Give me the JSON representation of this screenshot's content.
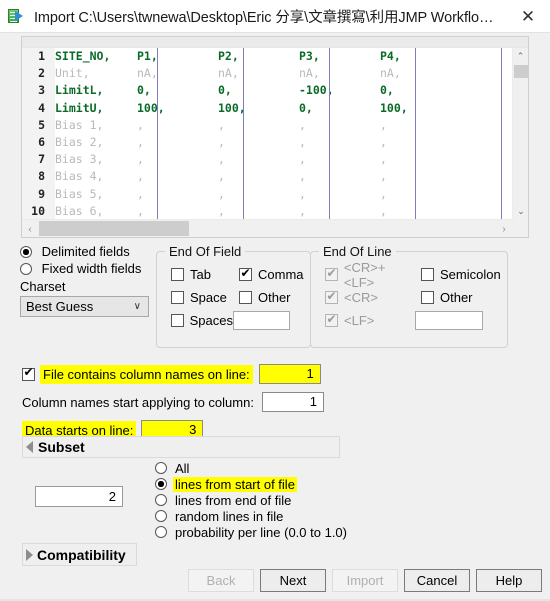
{
  "window": {
    "title": "Import C:\\Users\\twnewa\\Desktop\\Eric 分享\\文章撰寫\\利用JMP Workflow Builder ...",
    "close_label": "✕",
    "app_icon": "import-table-icon"
  },
  "preview": {
    "line_numbers": [
      "1",
      "2",
      "3",
      "4",
      "5",
      "6",
      "7",
      "8",
      "9",
      "10"
    ],
    "columns": [
      {
        "values": [
          "SITE_NO,",
          "Unit,",
          "LimitL,",
          "LimitU,",
          "Bias 1,",
          "Bias 2,",
          "Bias 3,",
          "Bias 4,",
          "Bias 5,",
          "Bias 6,"
        ],
        "styles": [
          "bold",
          "dim",
          "bold",
          "bold",
          "dim",
          "dim",
          "dim",
          "dim",
          "dim",
          "dim"
        ]
      },
      {
        "values": [
          "P1,",
          "nA,",
          "0,",
          "100,",
          ",",
          ",",
          ",",
          ",",
          ",",
          ","
        ],
        "styles": [
          "bold",
          "dim",
          "bold",
          "bold",
          "dim",
          "dim",
          "dim",
          "dim",
          "dim",
          "dim"
        ]
      },
      {
        "values": [
          "P2,",
          "nA,",
          "0,",
          "100,",
          ",",
          ",",
          ",",
          ",",
          ",",
          ","
        ],
        "styles": [
          "bold",
          "dim",
          "bold",
          "bold",
          "dim",
          "dim",
          "dim",
          "dim",
          "dim",
          "dim"
        ]
      },
      {
        "values": [
          "P3,",
          "nA,",
          "-100,",
          "0,",
          ",",
          ",",
          ",",
          ",",
          ",",
          ","
        ],
        "styles": [
          "bold",
          "dim",
          "bold",
          "bold",
          "dim",
          "dim",
          "dim",
          "dim",
          "dim",
          "dim"
        ]
      },
      {
        "values": [
          "P4,",
          "nA,",
          "0,",
          "100,",
          ",",
          ",",
          ",",
          ",",
          ",",
          ","
        ],
        "styles": [
          "bold",
          "dim",
          "bold",
          "bold",
          "dim",
          "dim",
          "dim",
          "dim",
          "dim",
          "dim"
        ]
      }
    ],
    "vscroll_up": "⌃",
    "vscroll_down": "⌄",
    "hscroll_left": "‹",
    "hscroll_right": "›"
  },
  "field_type": {
    "delimited_label": "Delimited fields",
    "delimited_selected": true,
    "fixed_label": "Fixed width fields",
    "fixed_selected": false
  },
  "charset": {
    "label": "Charset",
    "value": "Best Guess",
    "caret": "∨"
  },
  "end_of_field": {
    "legend": "End Of Field",
    "items": [
      {
        "label": "Tab",
        "checked": false
      },
      {
        "label": "Comma",
        "checked": true
      },
      {
        "label": "Space",
        "checked": false
      },
      {
        "label": "Other",
        "checked": false
      },
      {
        "label": "Spaces",
        "checked": false
      }
    ],
    "other_value": ""
  },
  "end_of_line": {
    "legend": "End Of Line",
    "items": [
      {
        "label": "<CR>+<LF>",
        "checked": true,
        "disabled": true
      },
      {
        "label": "Semicolon",
        "checked": false,
        "disabled": false
      },
      {
        "label": "<CR>",
        "checked": true,
        "disabled": true
      },
      {
        "label": "Other",
        "checked": false,
        "disabled": false
      },
      {
        "label": "<LF>",
        "checked": true,
        "disabled": true
      }
    ],
    "other_value": ""
  },
  "column_names": {
    "contains_checked": true,
    "contains_label": "File contains column names on line:",
    "contains_value": "1",
    "apply_label": "Column names start applying to column:",
    "apply_value": "1",
    "data_start_label": "Data starts on line:",
    "data_start_value": "3",
    "highlight_color": "#ffff00"
  },
  "subset": {
    "header": "Subset",
    "count_value": "2",
    "options": [
      {
        "label": "All",
        "selected": false,
        "highlighted": false
      },
      {
        "label": "lines from start of file",
        "selected": true,
        "highlighted": true
      },
      {
        "label": "lines from end of file",
        "selected": false,
        "highlighted": false
      },
      {
        "label": "random lines in file",
        "selected": false,
        "highlighted": false
      },
      {
        "label": "probability per line (0.0 to 1.0)",
        "selected": false,
        "highlighted": false
      }
    ]
  },
  "compatibility": {
    "header": "Compatibility"
  },
  "buttons": [
    {
      "label": "Back",
      "disabled": true,
      "default": false
    },
    {
      "label": "Next",
      "disabled": false,
      "default": true
    },
    {
      "label": "Import",
      "disabled": true,
      "default": false
    },
    {
      "label": "Cancel",
      "disabled": false,
      "default": true
    },
    {
      "label": "Help",
      "disabled": false,
      "default": true
    }
  ]
}
